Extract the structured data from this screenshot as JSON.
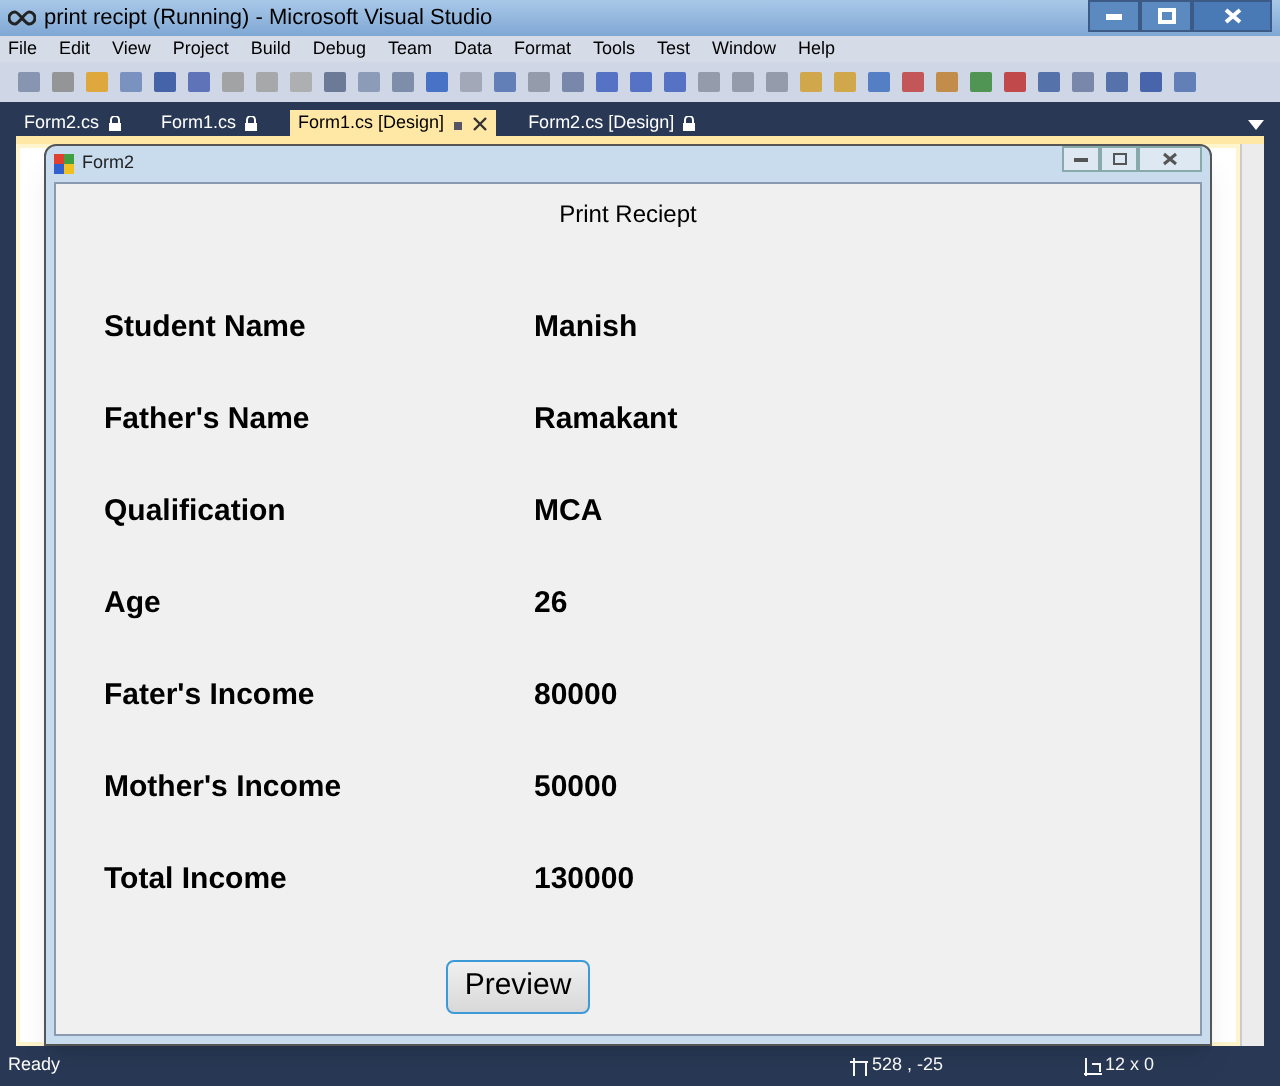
{
  "window": {
    "title": "print recipt (Running) - Microsoft Visual Studio"
  },
  "menu": [
    "File",
    "Edit",
    "View",
    "Project",
    "Build",
    "Debug",
    "Team",
    "Data",
    "Format",
    "Tools",
    "Test",
    "Window",
    "Help"
  ],
  "tabs": [
    {
      "label": "Form2.cs",
      "selected": false
    },
    {
      "label": "Form1.cs",
      "selected": false
    },
    {
      "label": "Form1.cs [Design]",
      "selected": true
    },
    {
      "label": "Form2.cs [Design]",
      "selected": false
    }
  ],
  "form": {
    "title": "Form2",
    "heading": "Print Reciept",
    "fields": [
      {
        "label": "Student Name",
        "value": "Manish"
      },
      {
        "label": "Father's Name",
        "value": "Ramakant"
      },
      {
        "label": "Qualification",
        "value": "MCA"
      },
      {
        "label": "Age",
        "value": "26"
      },
      {
        "label": "Fater's Income",
        "value": "80000"
      },
      {
        "label": "Mother's Income",
        "value": "50000"
      },
      {
        "label": "Total Income",
        "value": "130000"
      }
    ],
    "button": "Preview"
  },
  "status_bar": {
    "text": "Ready",
    "position": "528 , -25",
    "size": "12 x 0"
  }
}
